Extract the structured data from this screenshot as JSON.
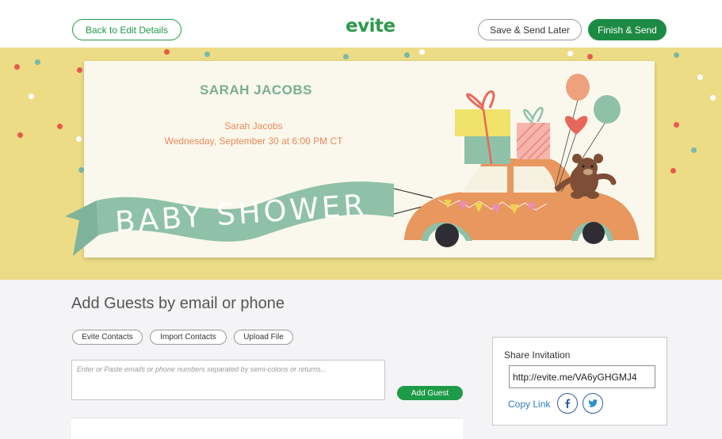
{
  "header": {
    "back_label": "Back to Edit Details",
    "logo_text": "evite",
    "save_later_label": "Save & Send Later",
    "finish_label": "Finish & Send",
    "brand_color": "#1d8a44"
  },
  "invitation": {
    "host_heading": "SARAH JACOBS",
    "host_name": "Sarah Jacobs",
    "date_line": "Wednesday, September 30 at 6:00 PM CT",
    "banner_text": "BABY SHOWER"
  },
  "guests": {
    "section_title": "Add Guests by email or phone",
    "buttons": [
      "Evite Contacts",
      "Import Contacts",
      "Upload File"
    ],
    "input_placeholder": "Enter or Paste emails or phone numbers separated by semi-colons or returns...",
    "add_guest_label": "Add Guest"
  },
  "share": {
    "title": "Share Invitation",
    "url": "http://evite.me/VA6yGHGMJ4",
    "copy_label": "Copy Link",
    "social_icons": [
      "facebook-icon",
      "twitter-icon"
    ]
  }
}
